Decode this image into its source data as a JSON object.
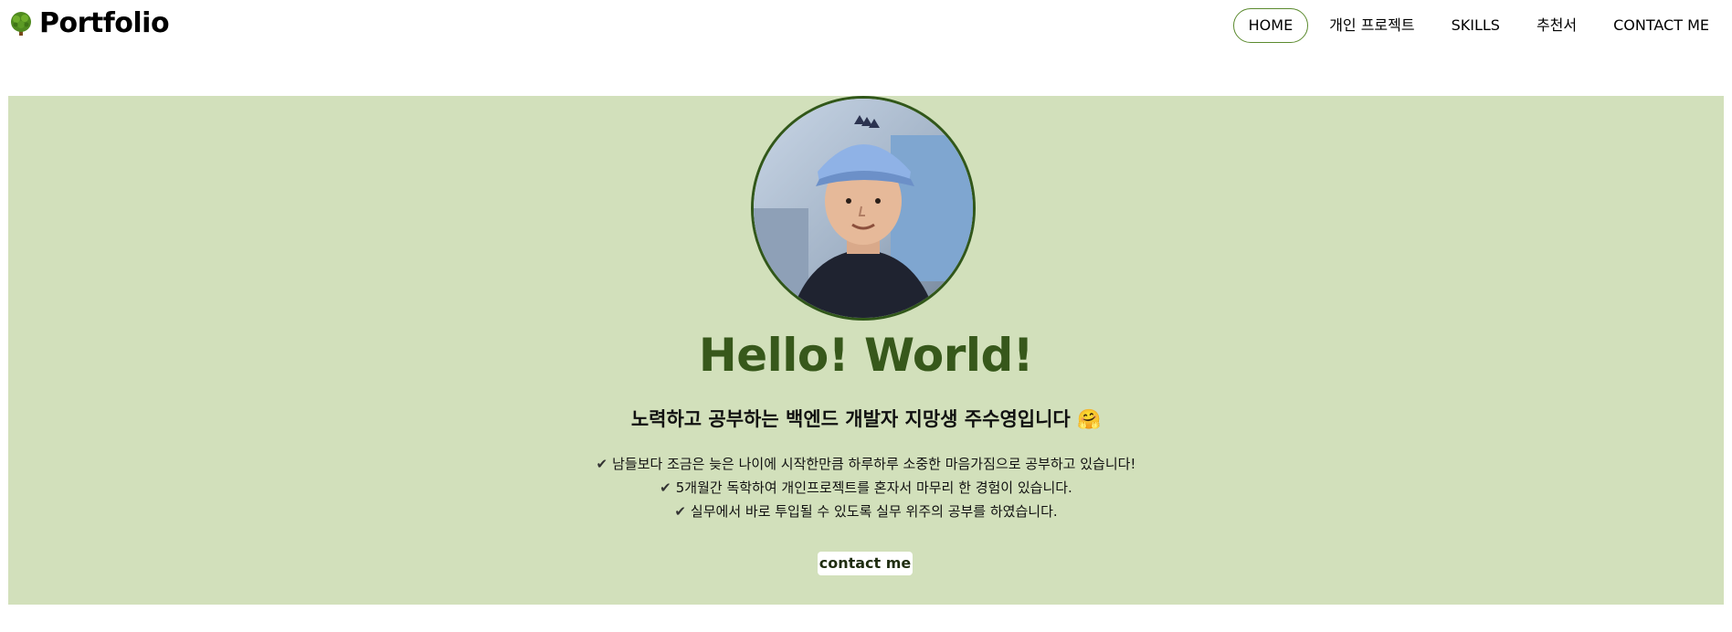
{
  "header": {
    "brand": "Portfolio",
    "brand_icon": "tree-icon",
    "nav": [
      {
        "label": "HOME",
        "active": true
      },
      {
        "label": "개인 프로젝트",
        "active": false
      },
      {
        "label": "SKILLS",
        "active": false
      },
      {
        "label": "추천서",
        "active": false
      },
      {
        "label": "CONTACT ME",
        "active": false
      }
    ]
  },
  "hero": {
    "title": "Hello! World!",
    "subtitle": "노력하고 공부하는 백엔드 개발자 지망생 주수영입니다 🤗",
    "points": [
      "남들보다 조금은 늦은 나이에 시작한만큼 하루하루 소중한 마음가짐으로 공부하고 있습니다!",
      "5개월간 독학하여 개인프로젝트를 혼자서 마무리 한 경험이 있습니다.",
      "실무에서 바로 투입될 수 있도록 실무 위주의 공부를 하였습니다."
    ],
    "check_icon": "✔",
    "contact_label": "contact me",
    "background_color": "#d2e0bb",
    "title_color": "#37581b"
  }
}
